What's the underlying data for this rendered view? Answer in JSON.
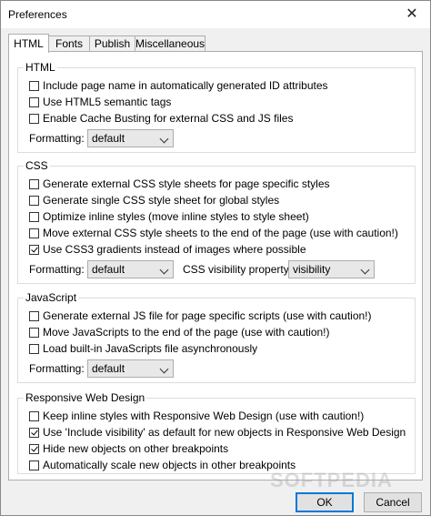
{
  "window": {
    "title": "Preferences",
    "close_glyph": "✕"
  },
  "tabs": [
    {
      "label": "HTML",
      "active": true
    },
    {
      "label": "Fonts",
      "active": false
    },
    {
      "label": "Publish",
      "active": false
    },
    {
      "label": "Miscellaneous",
      "active": false
    }
  ],
  "html_group": {
    "title": "HTML",
    "options": [
      {
        "label": "Include page name in automatically generated ID attributes",
        "checked": false
      },
      {
        "label": "Use HTML5 semantic tags",
        "checked": false
      },
      {
        "label": "Enable Cache Busting for external CSS and JS files",
        "checked": false
      }
    ],
    "formatting_label": "Formatting:",
    "formatting_value": "default"
  },
  "css_group": {
    "title": "CSS",
    "options": [
      {
        "label": "Generate external CSS style sheets for page specific styles",
        "checked": false
      },
      {
        "label": "Generate single CSS style sheet for global styles",
        "checked": false
      },
      {
        "label": "Optimize inline styles (move inline styles to style sheet)",
        "checked": false
      },
      {
        "label": "Move external CSS style sheets to the end of the page (use with caution!)",
        "checked": false
      },
      {
        "label": "Use CSS3 gradients instead of images where possible",
        "checked": true
      }
    ],
    "formatting_label": "Formatting:",
    "formatting_value": "default",
    "visibility_label": "CSS visibility property:",
    "visibility_value": "visibility"
  },
  "js_group": {
    "title": "JavaScript",
    "options": [
      {
        "label": "Generate external JS file for page specific scripts (use with caution!)",
        "checked": false
      },
      {
        "label": "Move JavaScripts to the end of the page (use with caution!)",
        "checked": false
      },
      {
        "label": "Load built-in JavaScripts file asynchronously",
        "checked": false
      }
    ],
    "formatting_label": "Formatting:",
    "formatting_value": "default"
  },
  "rwd_group": {
    "title": "Responsive Web Design",
    "options": [
      {
        "label": "Keep inline styles with Responsive Web Design (use with caution!)",
        "checked": false
      },
      {
        "label": "Use 'Include visibility' as default for new objects in Responsive Web Design",
        "checked": true
      },
      {
        "label": "Hide new objects on other breakpoints",
        "checked": true
      },
      {
        "label": "Automatically scale new objects in other breakpoints",
        "checked": false
      }
    ]
  },
  "buttons": {
    "ok": "OK",
    "cancel": "Cancel"
  },
  "watermark": "SOFTPEDIA"
}
